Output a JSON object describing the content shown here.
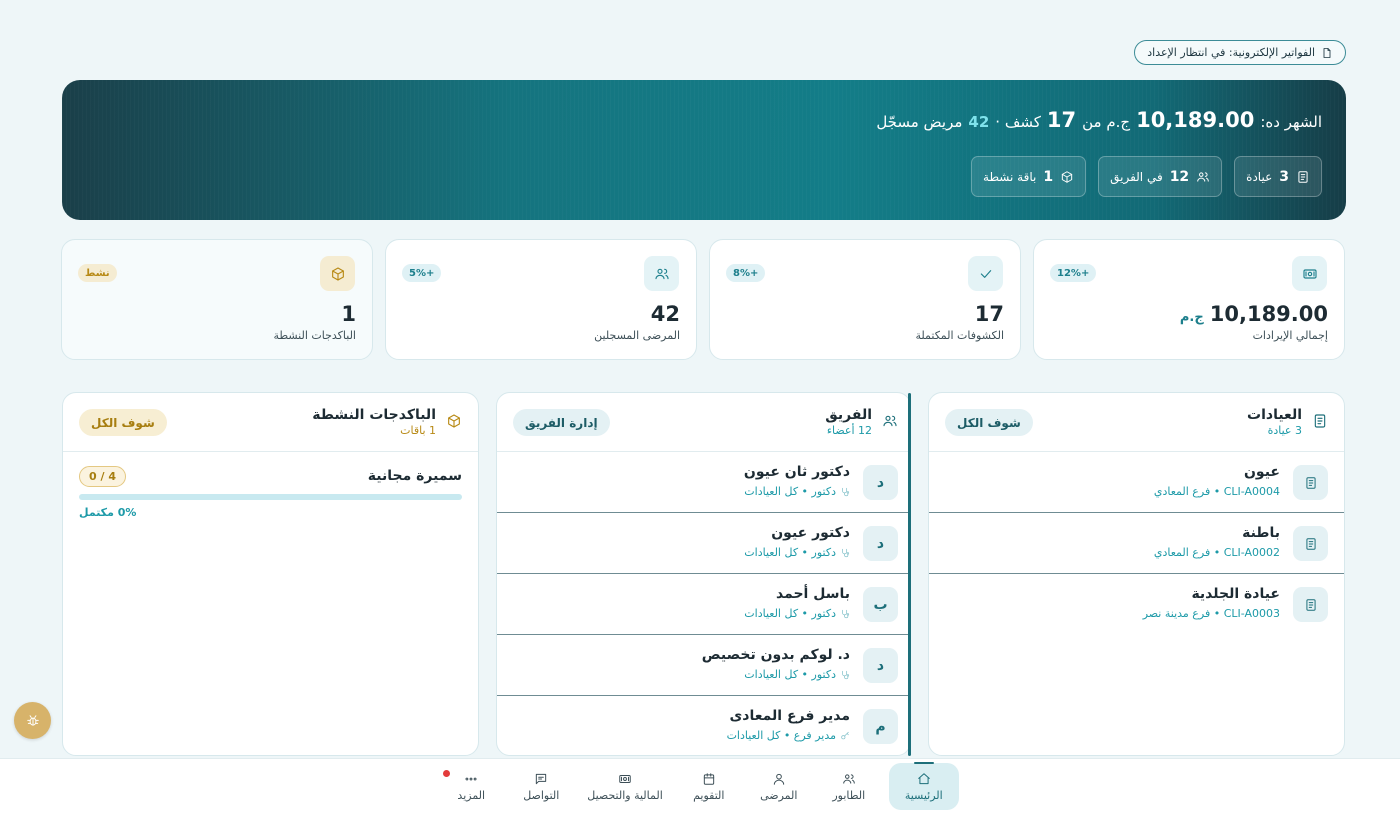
{
  "banner": {
    "icon": "document-icon",
    "text": "الفواتير الإلكترونية: في انتظار الإعداد"
  },
  "hero": {
    "label": "الشهر ده:",
    "amount": "10,189.00",
    "currency_from": "ج.م من",
    "visits": "17",
    "visits_label": "كشف ·",
    "patients": "42",
    "patients_label": "مريض مسجّل",
    "chips": [
      {
        "icon": "clinic-icon",
        "value": "3",
        "label": "عيادة"
      },
      {
        "icon": "team-icon",
        "value": "12",
        "label": "في الفريق"
      },
      {
        "icon": "package-icon",
        "value": "1",
        "label": "باقة نشطة"
      }
    ]
  },
  "stats": [
    {
      "icon": "cash-icon",
      "badge": "+12%",
      "value": "10,189.00",
      "unit": "ج.م",
      "label": "إجمالي الإيرادات"
    },
    {
      "icon": "check-icon",
      "badge": "+8%",
      "value": "17",
      "unit": "",
      "label": "الكشوفات المكتملة"
    },
    {
      "icon": "users-icon",
      "badge": "+5%",
      "value": "42",
      "unit": "",
      "label": "المرضى المسجلين"
    },
    {
      "icon": "package-icon",
      "badge": "نشط",
      "value": "1",
      "unit": "",
      "label": "الباكدجات النشطة"
    }
  ],
  "clinics_panel": {
    "title": "العيادات",
    "subtitle": "3 عيادة",
    "button": "شوف الكل",
    "items": [
      {
        "name": "عيون",
        "detail": "CLI-A0004 • فرع المعادي"
      },
      {
        "name": "باطنة",
        "detail": "CLI-A0002 • فرع المعادي"
      },
      {
        "name": "عيادة الجلدية",
        "detail": "CLI-A0003 • فرع مدينة نصر"
      }
    ]
  },
  "team_panel": {
    "title": "الفريق",
    "subtitle": "12 أعضاء",
    "button": "إدارة الفريق",
    "members": [
      {
        "initial": "د",
        "name": "دكتور ثان عيون",
        "role": "دكتور • كل العيادات"
      },
      {
        "initial": "د",
        "name": "دكتور عيون",
        "role": "دكتور • كل العيادات"
      },
      {
        "initial": "ب",
        "name": "باسل أحمد",
        "role": "دكتور • كل العيادات"
      },
      {
        "initial": "د",
        "name": "د. لوكم بدون تخصيص",
        "role": "دكتور • كل العيادات"
      },
      {
        "initial": "م",
        "name": "مدير فرع المعادى",
        "role": "مدير فرع • كل العيادات"
      }
    ]
  },
  "packages_panel": {
    "title": "الباكدجات النشطة",
    "subtitle": "1 باقات",
    "button": "شوف الكل",
    "items": [
      {
        "name": "سميرة مجانية",
        "count": "4 / 0",
        "progress_percent": 0,
        "progress_label": "0% مكتمل"
      }
    ]
  },
  "bottom_nav": [
    {
      "icon": "home-icon",
      "label": "الرئيسية",
      "active": true
    },
    {
      "icon": "queue-icon",
      "label": "الطابور"
    },
    {
      "icon": "patient-icon",
      "label": "المرضى"
    },
    {
      "icon": "calendar-icon",
      "label": "التقويم"
    },
    {
      "icon": "cash-icon",
      "label": "المالية والتحصيل"
    },
    {
      "icon": "chat-icon",
      "label": "التواصل"
    },
    {
      "icon": "more-icon",
      "label": "المزيد",
      "has_notification": true
    }
  ],
  "fab": {
    "icon": "bug-icon"
  }
}
